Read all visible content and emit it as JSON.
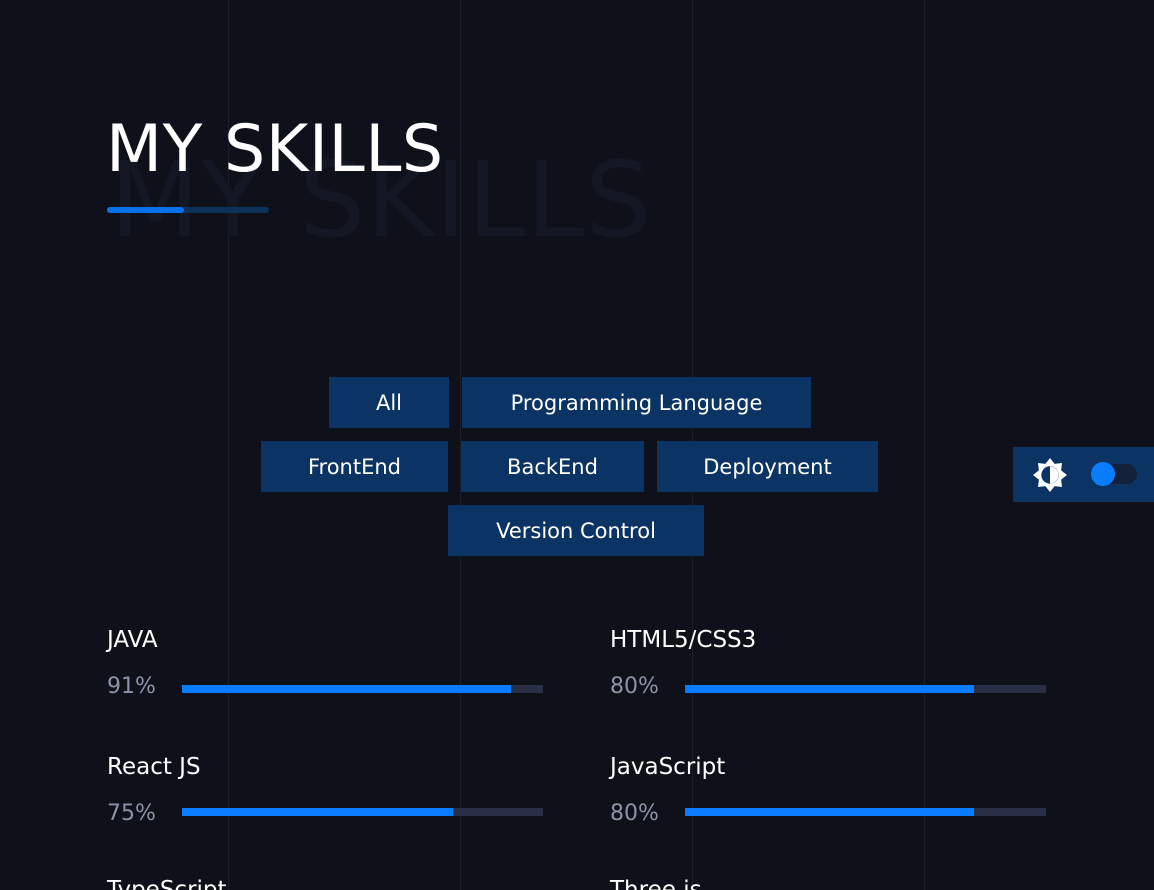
{
  "section": {
    "title": "MY SKILLS",
    "background_title": "MY SKILLS"
  },
  "filters": [
    {
      "label": "All"
    },
    {
      "label": "Programming Language"
    },
    {
      "label": "FrontEnd"
    },
    {
      "label": "BackEnd"
    },
    {
      "label": "Deployment"
    },
    {
      "label": "Version Control"
    }
  ],
  "theme_toggle": {
    "icon": "brightness-icon",
    "state": "off"
  },
  "skills": [
    {
      "name": "JAVA",
      "percent_label": "91%",
      "level": 0.91
    },
    {
      "name": "HTML5/CSS3",
      "percent_label": "80%",
      "level": 0.8
    },
    {
      "name": "React JS",
      "percent_label": "75%",
      "level": 0.75
    },
    {
      "name": "JavaScript",
      "percent_label": "80%",
      "level": 0.8
    },
    {
      "name": "TypeScript"
    },
    {
      "name": "Three.js"
    }
  ],
  "colors": {
    "background": "#0e1119",
    "accent": "#0a7cff",
    "button_bg": "#0b3363",
    "bar_track": "#2b2f45",
    "percent_text": "#8c93a8"
  }
}
